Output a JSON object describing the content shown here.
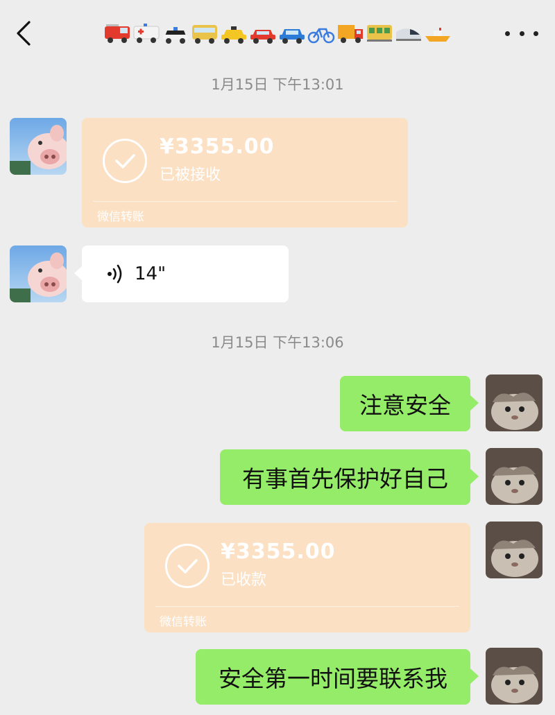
{
  "header": {
    "title_emojis": [
      "fire-truck",
      "ambulance",
      "police-car",
      "bus",
      "taxi",
      "red-car",
      "blue-car",
      "bicycle",
      "truck",
      "tram",
      "bullet-train",
      "boat"
    ]
  },
  "messages": {
    "time1": "1月15日 下午13:01",
    "transfer1": {
      "amount": "¥3355.00",
      "status": "已被接收",
      "footer": "微信转账"
    },
    "voice": {
      "duration": "14\""
    },
    "time2": "1月15日 下午13:06",
    "msg1": "注意安全",
    "msg2": "有事首先保护好自己",
    "transfer2": {
      "amount": "¥3355.00",
      "status": "已收款",
      "footer": "微信转账"
    },
    "msg3": "安全第一时间要联系我"
  },
  "colors": {
    "background": "#ededed",
    "green_bubble": "#95ec69",
    "transfer_bubble": "#fbe0c3",
    "timestamp": "#8a8a8a"
  }
}
